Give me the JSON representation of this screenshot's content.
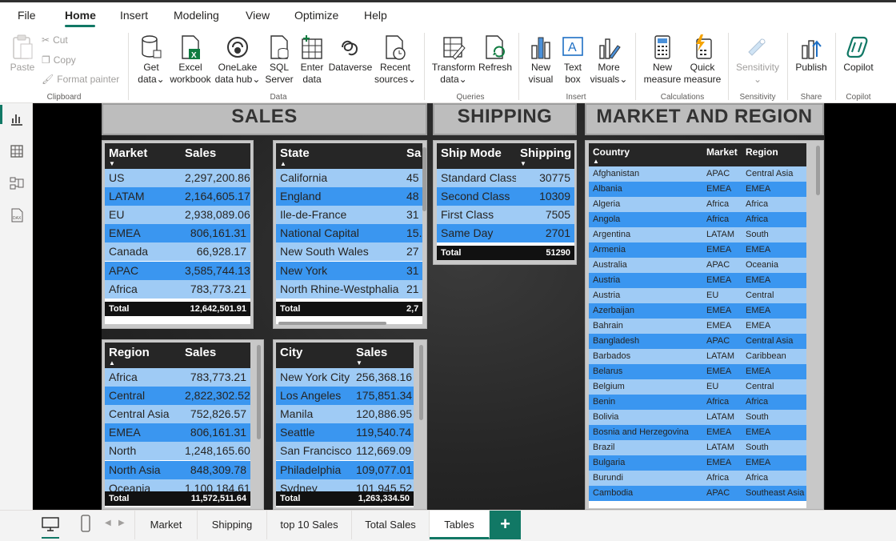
{
  "menu": {
    "items": [
      "File",
      "Home",
      "Insert",
      "Modeling",
      "View",
      "Optimize",
      "Help"
    ],
    "active": "Home"
  },
  "ribbon": {
    "clipboard": {
      "paste": "Paste",
      "cut": "Cut",
      "copy": "Copy",
      "format_painter": "Format painter",
      "label": "Clipboard"
    },
    "data": {
      "get_data": [
        "Get",
        "data"
      ],
      "excel": [
        "Excel",
        "workbook"
      ],
      "onelake": [
        "OneLake",
        "data hub"
      ],
      "sql": [
        "SQL",
        "Server"
      ],
      "enter": [
        "Enter",
        "data"
      ],
      "dataverse": "Dataverse",
      "recent": [
        "Recent",
        "sources"
      ],
      "label": "Data"
    },
    "queries": {
      "transform": [
        "Transform",
        "data"
      ],
      "refresh": "Refresh",
      "label": "Queries"
    },
    "insert": {
      "new_visual": [
        "New",
        "visual"
      ],
      "text_box": [
        "Text",
        "box"
      ],
      "more_visuals": [
        "More",
        "visuals"
      ],
      "label": "Insert"
    },
    "calculations": {
      "new_measure": [
        "New",
        "measure"
      ],
      "quick_measure": [
        "Quick",
        "measure"
      ],
      "label": "Calculations"
    },
    "sensitivity": {
      "btn": "Sensitivity",
      "label": "Sensitivity"
    },
    "share": {
      "publish": "Publish",
      "label": "Share"
    },
    "copilot": {
      "btn": "Copilot",
      "label": "Copilot"
    }
  },
  "headers": {
    "sales": "SALES",
    "shipping": "SHIPPING",
    "market_region": "MARKET AND REGION"
  },
  "market_table": {
    "cols": [
      "Market",
      "Sales"
    ],
    "rows": [
      [
        "US",
        "2,297,200.86"
      ],
      [
        "LATAM",
        "2,164,605.17"
      ],
      [
        "EU",
        "2,938,089.06"
      ],
      [
        "EMEA",
        "806,161.31"
      ],
      [
        "Canada",
        "66,928.17"
      ],
      [
        "APAC",
        "3,585,744.13"
      ],
      [
        "Africa",
        "783,773.21"
      ]
    ],
    "total": [
      "Total",
      "12,642,501.91"
    ]
  },
  "state_table": {
    "cols": [
      "State",
      "Sa"
    ],
    "rows": [
      [
        "California",
        "45"
      ],
      [
        "England",
        "48"
      ],
      [
        "Ile-de-France",
        "31"
      ],
      [
        "National Capital",
        "15."
      ],
      [
        "New South Wales",
        "27"
      ],
      [
        "New York",
        "31"
      ],
      [
        "North Rhine-Westphalia",
        "21"
      ]
    ],
    "total": [
      "Total",
      "2,7"
    ]
  },
  "ship_table": {
    "cols": [
      "Ship Mode",
      "Shipping"
    ],
    "rows": [
      [
        "Standard Class",
        "30775"
      ],
      [
        "Second Class",
        "10309"
      ],
      [
        "First Class",
        "7505"
      ],
      [
        "Same Day",
        "2701"
      ]
    ],
    "total": [
      "Total",
      "51290"
    ]
  },
  "region_table": {
    "cols": [
      "Region",
      "Sales"
    ],
    "rows": [
      [
        "Africa",
        "783,773.21"
      ],
      [
        "Central",
        "2,822,302.52"
      ],
      [
        "Central Asia",
        "752,826.57"
      ],
      [
        "EMEA",
        "806,161.31"
      ],
      [
        "North",
        "1,248,165.60"
      ],
      [
        "North Asia",
        "848,309.78"
      ],
      [
        "Oceania",
        "1,100,184.61"
      ]
    ],
    "total": [
      "Total",
      "11,572,511.64"
    ]
  },
  "city_table": {
    "cols": [
      "City",
      "Sales"
    ],
    "rows": [
      [
        "New York City",
        "256,368.16"
      ],
      [
        "Los Angeles",
        "175,851.34"
      ],
      [
        "Manila",
        "120,886.95"
      ],
      [
        "Seattle",
        "119,540.74"
      ],
      [
        "San Francisco",
        "112,669.09"
      ],
      [
        "Philadelphia",
        "109,077.01"
      ],
      [
        "Sydney",
        "101,945.52"
      ]
    ],
    "total": [
      "Total",
      "1,263,334.50"
    ]
  },
  "country_table": {
    "cols": [
      "Country",
      "Market",
      "Region"
    ],
    "rows": [
      [
        "Afghanistan",
        "APAC",
        "Central Asia"
      ],
      [
        "Albania",
        "EMEA",
        "EMEA"
      ],
      [
        "Algeria",
        "Africa",
        "Africa"
      ],
      [
        "Angola",
        "Africa",
        "Africa"
      ],
      [
        "Argentina",
        "LATAM",
        "South"
      ],
      [
        "Armenia",
        "EMEA",
        "EMEA"
      ],
      [
        "Australia",
        "APAC",
        "Oceania"
      ],
      [
        "Austria",
        "EMEA",
        "EMEA"
      ],
      [
        "Austria",
        "EU",
        "Central"
      ],
      [
        "Azerbaijan",
        "EMEA",
        "EMEA"
      ],
      [
        "Bahrain",
        "EMEA",
        "EMEA"
      ],
      [
        "Bangladesh",
        "APAC",
        "Central Asia"
      ],
      [
        "Barbados",
        "LATAM",
        "Caribbean"
      ],
      [
        "Belarus",
        "EMEA",
        "EMEA"
      ],
      [
        "Belgium",
        "EU",
        "Central"
      ],
      [
        "Benin",
        "Africa",
        "Africa"
      ],
      [
        "Bolivia",
        "LATAM",
        "South"
      ],
      [
        "Bosnia and Herzegovina",
        "EMEA",
        "EMEA"
      ],
      [
        "Brazil",
        "LATAM",
        "South"
      ],
      [
        "Bulgaria",
        "EMEA",
        "EMEA"
      ],
      [
        "Burundi",
        "Africa",
        "Africa"
      ],
      [
        "Cambodia",
        "APAC",
        "Southeast Asia"
      ]
    ]
  },
  "tabs": [
    "Market",
    "Shipping",
    "top 10 Sales",
    "Total Sales",
    "Tables"
  ],
  "active_tab": "Tables",
  "add_tab": "+"
}
